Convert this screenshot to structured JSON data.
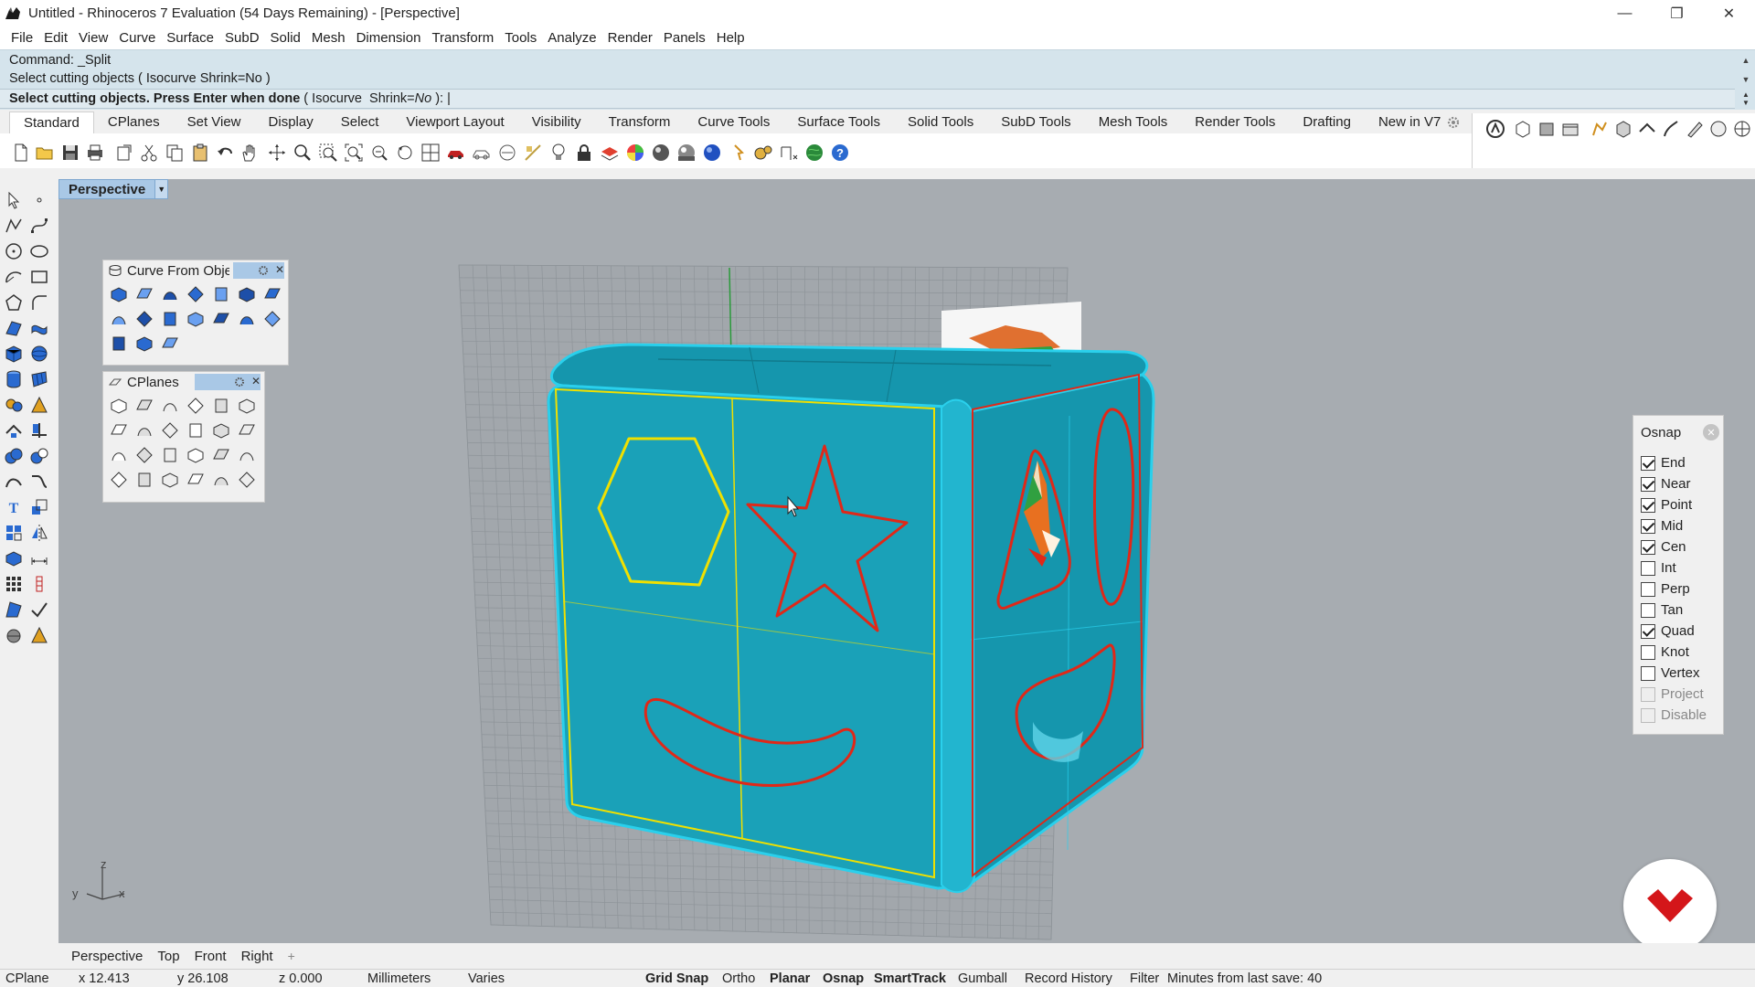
{
  "window": {
    "title": "Untitled - Rhinoceros 7 Evaluation (54 Days Remaining) - [Perspective]",
    "minimize": "—",
    "restore": "❐",
    "close": "✕"
  },
  "menu": [
    "File",
    "Edit",
    "View",
    "Curve",
    "Surface",
    "SubD",
    "Solid",
    "Mesh",
    "Dimension",
    "Transform",
    "Tools",
    "Analyze",
    "Render",
    "Panels",
    "Help"
  ],
  "command": {
    "history_1": "Command: _Split",
    "history_2": "Select cutting objects ( Isocurve  Shrink=No )",
    "prompt_bold": "Select cutting objects. Press Enter when done",
    "prompt_open": " ( ",
    "opt_isocurve": "Isocurve",
    "opt_shrink_label": "Shrink=",
    "opt_shrink_value": "No",
    "prompt_close": " ): "
  },
  "toolbar_tabs": [
    "Standard",
    "CPlanes",
    "Set View",
    "Display",
    "Select",
    "Viewport Layout",
    "Visibility",
    "Transform",
    "Curve Tools",
    "Surface Tools",
    "Solid Tools",
    "SubD Tools",
    "Mesh Tools",
    "Render Tools",
    "Drafting",
    "New in V7"
  ],
  "viewport": {
    "name": "Perspective",
    "axis_x": "x",
    "axis_y": "y",
    "axis_z": "z"
  },
  "panels": {
    "curve_from_object": {
      "title": "Curve From Obje"
    },
    "cplanes": {
      "title": "CPlanes"
    }
  },
  "osnap": {
    "title": "Osnap",
    "items": [
      {
        "label": "End",
        "checked": true,
        "disabled": false
      },
      {
        "label": "Near",
        "checked": true,
        "disabled": false
      },
      {
        "label": "Point",
        "checked": true,
        "disabled": false
      },
      {
        "label": "Mid",
        "checked": true,
        "disabled": false
      },
      {
        "label": "Cen",
        "checked": true,
        "disabled": false
      },
      {
        "label": "Int",
        "checked": false,
        "disabled": false
      },
      {
        "label": "Perp",
        "checked": false,
        "disabled": false
      },
      {
        "label": "Tan",
        "checked": false,
        "disabled": false
      },
      {
        "label": "Quad",
        "checked": true,
        "disabled": false
      },
      {
        "label": "Knot",
        "checked": false,
        "disabled": false
      },
      {
        "label": "Vertex",
        "checked": false,
        "disabled": false
      },
      {
        "label": "Project",
        "checked": false,
        "disabled": true
      },
      {
        "label": "Disable",
        "checked": false,
        "disabled": true
      }
    ]
  },
  "viewport_tabs": [
    "Perspective",
    "Top",
    "Front",
    "Right"
  ],
  "viewport_tab_add": "+",
  "status": {
    "cplane": "CPlane",
    "x": "x 12.413",
    "y": "y 26.108",
    "z": "z 0.000",
    "units": "Millimeters",
    "layer": "Varies",
    "grid_snap": "Grid Snap",
    "ortho": "Ortho",
    "planar": "Planar",
    "osnap": "Osnap",
    "smarttrack": "SmartTrack",
    "gumball": "Gumball",
    "record_history": "Record History",
    "filter": "Filter",
    "save_info": "Minutes from last save: 40"
  },
  "colors": {
    "viewport_bg": "#a7acb1",
    "cube_front": "#1aa1b8",
    "cube_side": "#1596ad",
    "cube_edge": "#2ad0ec",
    "selection_yellow": "#f0e000",
    "curve_red": "#e02818",
    "command_bg": "#d5e4ec",
    "logo_red": "#d4161a"
  }
}
